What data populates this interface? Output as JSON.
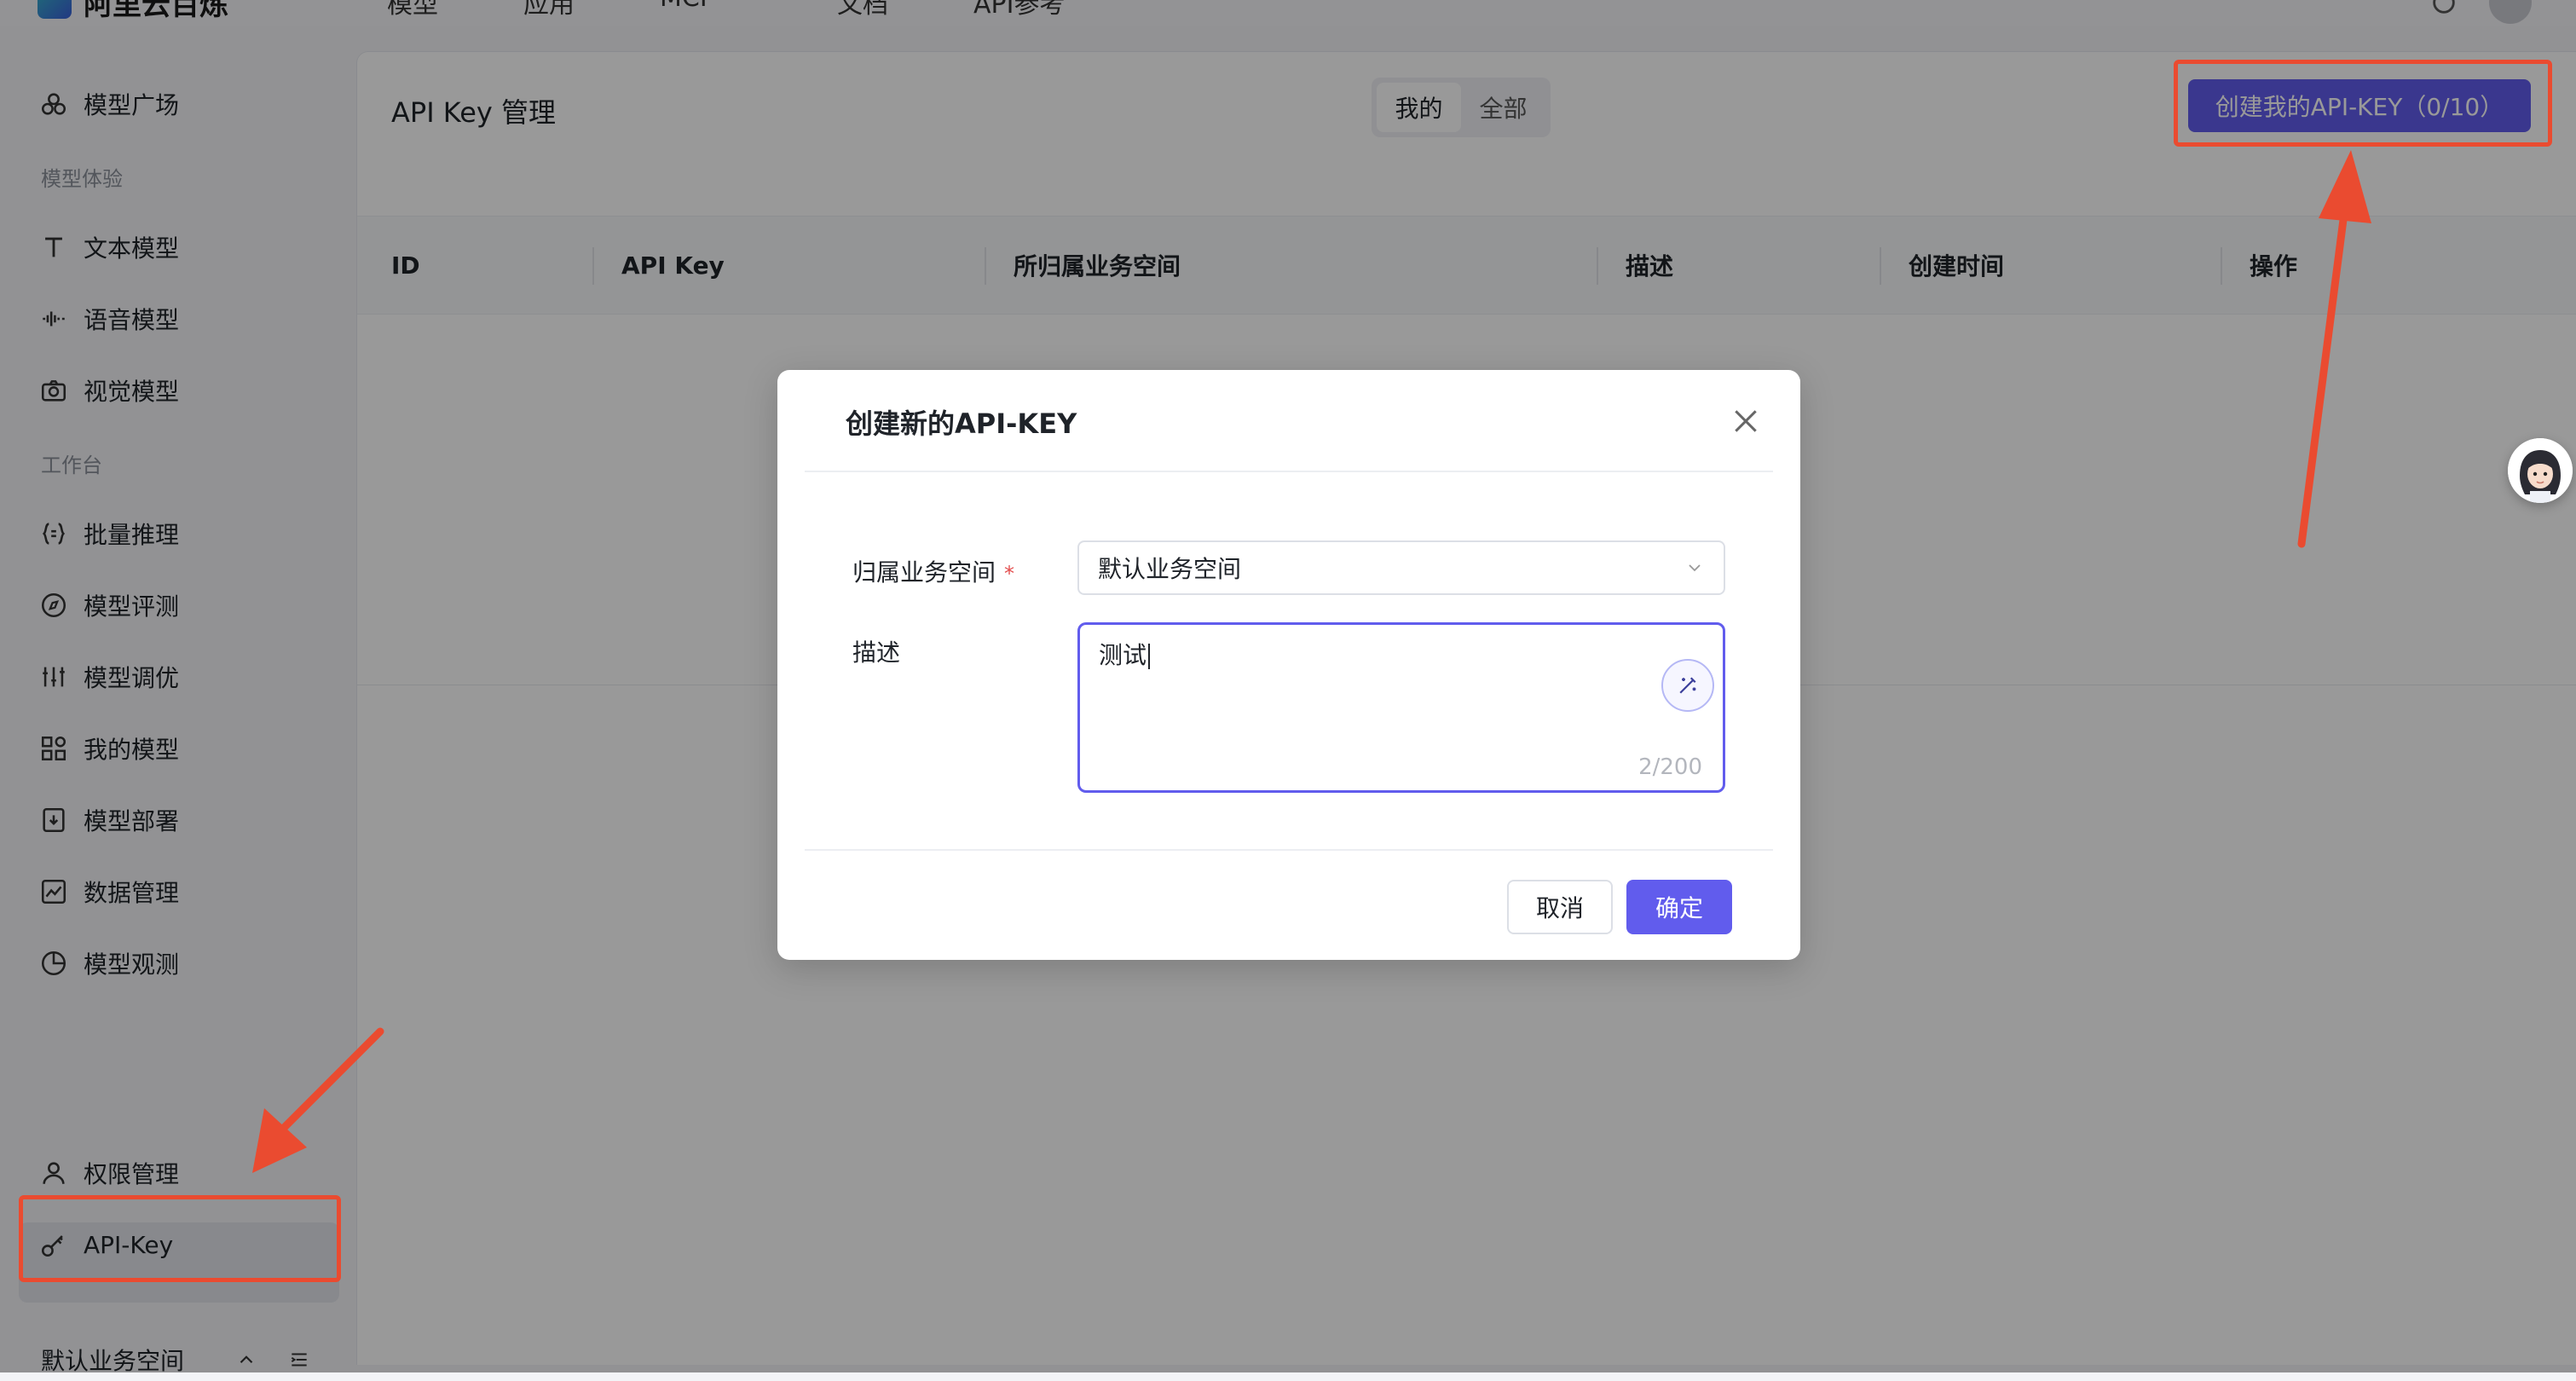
{
  "topnav": {
    "logo_text": "阿里云百炼",
    "items": [
      "模型",
      "应用",
      "MCP",
      "文档",
      "API参考"
    ]
  },
  "sidebar": {
    "items": [
      {
        "label": "模型广场",
        "icon": "model-square-icon"
      },
      {
        "label": "文本模型",
        "icon": "text-icon"
      },
      {
        "label": "语音模型",
        "icon": "audio-wave-icon"
      },
      {
        "label": "视觉模型",
        "icon": "camera-icon"
      },
      {
        "label": "批量推理",
        "icon": "braces-icon"
      },
      {
        "label": "模型评测",
        "icon": "compass-icon"
      },
      {
        "label": "模型调优",
        "icon": "sliders-icon"
      },
      {
        "label": "我的模型",
        "icon": "grid-icon"
      },
      {
        "label": "模型部署",
        "icon": "deploy-icon"
      },
      {
        "label": "数据管理",
        "icon": "chart-icon"
      },
      {
        "label": "模型观测",
        "icon": "pie-icon"
      },
      {
        "label": "权限管理",
        "icon": "user-icon"
      },
      {
        "label": "API-Key",
        "icon": "key-icon"
      }
    ],
    "sections": {
      "experience": "模型体验",
      "workbench": "工作台"
    },
    "workspace_label": "默认业务空间"
  },
  "main": {
    "title": "API Key 管理",
    "segments": [
      "我的",
      "全部"
    ],
    "create_button": "创建我的API-KEY（0/10）",
    "table_headers": [
      "ID",
      "API Key",
      "所归属业务空间",
      "描述",
      "创建时间",
      "操作"
    ]
  },
  "modal": {
    "title": "创建新的API-KEY",
    "workspace_label": "归属业务空间",
    "required_mark": "*",
    "workspace_value": "默认业务空间",
    "description_label": "描述",
    "description_value": "测试",
    "char_count": "2/200",
    "cancel_label": "取消",
    "ok_label": "确定"
  },
  "colors": {
    "accent": "#615ced",
    "annotation": "#ea4b30",
    "overlay": "rgba(0,0,0,0.40)"
  }
}
